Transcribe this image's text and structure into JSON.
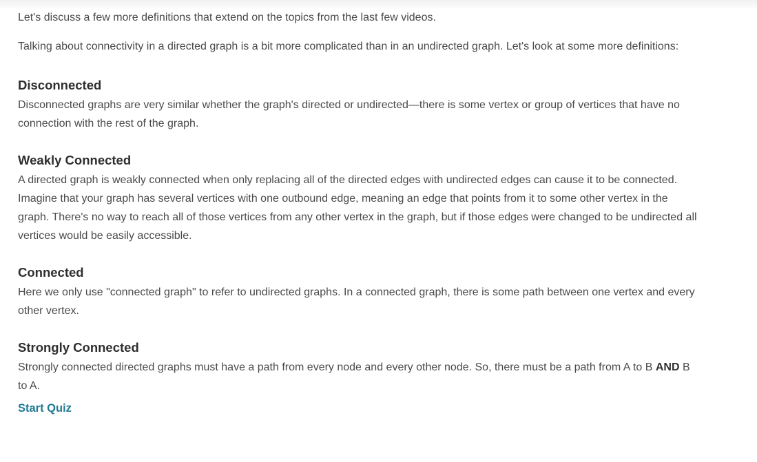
{
  "intro": {
    "line1": "Let's discuss a few more definitions that extend on the topics from the last few videos.",
    "line2": "Talking about connectivity in a directed graph is a bit more complicated than in an undirected graph. Let's look at some more definitions:"
  },
  "sections": [
    {
      "heading": "Disconnected",
      "body": "Disconnected graphs are very similar whether the graph's directed or undirected—there is some vertex or group of vertices that have no connection with the rest of the graph."
    },
    {
      "heading": "Weakly Connected",
      "body": "A directed graph is weakly connected when only replacing all of the directed edges with undirected edges can cause it to be connected. Imagine that your graph has several vertices with one outbound edge, meaning an edge that points from it to some other vertex in the graph. There's no way to reach all of those vertices from any other vertex in the graph, but if those edges were changed to be undirected all vertices would be easily accessible."
    },
    {
      "heading": "Connected",
      "body": "Here we only use \"connected graph\" to refer to undirected graphs. In a connected graph, there is some path between one vertex and every other vertex."
    },
    {
      "heading": "Strongly Connected",
      "body_before": "Strongly connected directed graphs must have a path from every node and every other node. So, there must be a path from A to B ",
      "body_bold": "AND",
      "body_after": " B to A."
    }
  ],
  "quiz_link": "Start Quiz",
  "colors": {
    "text": "#4a4a4a",
    "heading": "#2e2e2e",
    "link": "#1f7a93"
  }
}
